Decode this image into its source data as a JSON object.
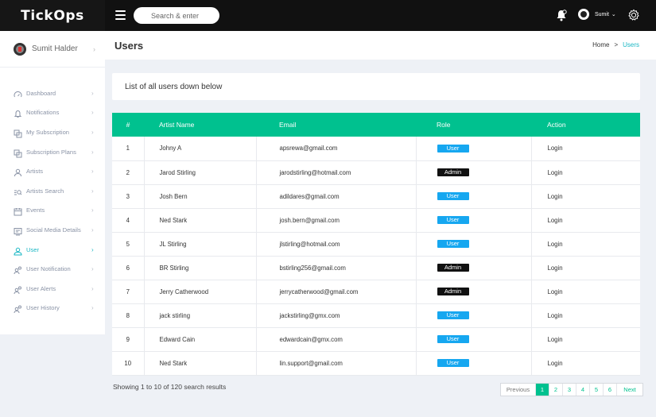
{
  "app": {
    "logo": "TickOps"
  },
  "topbar": {
    "search_placeholder": "Search & enter",
    "user_name": "Sumit",
    "user_caret": "⌄"
  },
  "sidebar": {
    "profile_name": "Sumit Halder",
    "items": [
      {
        "label": "Dashboard",
        "icon": "dashboard-icon",
        "active": false
      },
      {
        "label": "Notifications",
        "icon": "bell-icon",
        "active": false
      },
      {
        "label": "My Subscription",
        "icon": "subscription-icon",
        "active": false
      },
      {
        "label": "Subscription Plans",
        "icon": "subscription-icon",
        "active": false
      },
      {
        "label": "Artists",
        "icon": "artist-icon",
        "active": false
      },
      {
        "label": "Artists Search",
        "icon": "search-list-icon",
        "active": false
      },
      {
        "label": "Events",
        "icon": "calendar-icon",
        "active": false
      },
      {
        "label": "Social Media Details",
        "icon": "social-icon",
        "active": false
      },
      {
        "label": "User",
        "icon": "user-icon",
        "active": true
      },
      {
        "label": "User Notification",
        "icon": "users-icon",
        "active": false
      },
      {
        "label": "User Alerts",
        "icon": "users-icon",
        "active": false
      },
      {
        "label": "User History",
        "icon": "users-icon",
        "active": false
      }
    ],
    "active_color": "#1ab7c4"
  },
  "header": {
    "title": "Users",
    "breadcrumb_home": "Home",
    "breadcrumb_sep": ">",
    "breadcrumb_current": "Users"
  },
  "info": {
    "text": "List of all users down below"
  },
  "table": {
    "headers": [
      "#",
      "Artist Name",
      "Email",
      "Role",
      "Action"
    ],
    "rows": [
      {
        "idx": "1",
        "name": "Johny A",
        "email": "apsrewa@gmail.com",
        "role": "User",
        "action": "Login"
      },
      {
        "idx": "2",
        "name": "Jarod Stirling",
        "email": "jarodstirling@hotmail.com",
        "role": "Admin",
        "action": "Login"
      },
      {
        "idx": "3",
        "name": "Josh Bern",
        "email": "adildares@gmail.com",
        "role": "User",
        "action": "Login"
      },
      {
        "idx": "4",
        "name": "Ned Stark",
        "email": "josh.bern@gmail.com",
        "role": "User",
        "action": "Login"
      },
      {
        "idx": "5",
        "name": "JL Stirling",
        "email": "jlstirling@hotmail.com",
        "role": "User",
        "action": "Login"
      },
      {
        "idx": "6",
        "name": "BR Stirling",
        "email": "bstirling256@gmail.com",
        "role": "Admin",
        "action": "Login"
      },
      {
        "idx": "7",
        "name": "Jerry Catherwood",
        "email": "jerrycatherwood@gmail.com",
        "role": "Admin",
        "action": "Login"
      },
      {
        "idx": "8",
        "name": "jack stirling",
        "email": "jackstirling@gmx.com",
        "role": "User",
        "action": "Login"
      },
      {
        "idx": "9",
        "name": "Edward Cain",
        "email": "edwardcain@gmx.com",
        "role": "User",
        "action": "Login"
      },
      {
        "idx": "10",
        "name": "Ned Stark",
        "email": "lin.support@gmail.com",
        "role": "User",
        "action": "Login"
      }
    ],
    "header_color": "#00c18f",
    "user_badge_color": "#16a7f0",
    "admin_badge_color": "#111111"
  },
  "footer": {
    "summary": "Showing 1 to 10 of 120 search results",
    "pagination": {
      "prev": "Previous",
      "pages": [
        "1",
        "2",
        "3",
        "4",
        "5",
        "6"
      ],
      "current": "1",
      "next": "Next"
    }
  }
}
